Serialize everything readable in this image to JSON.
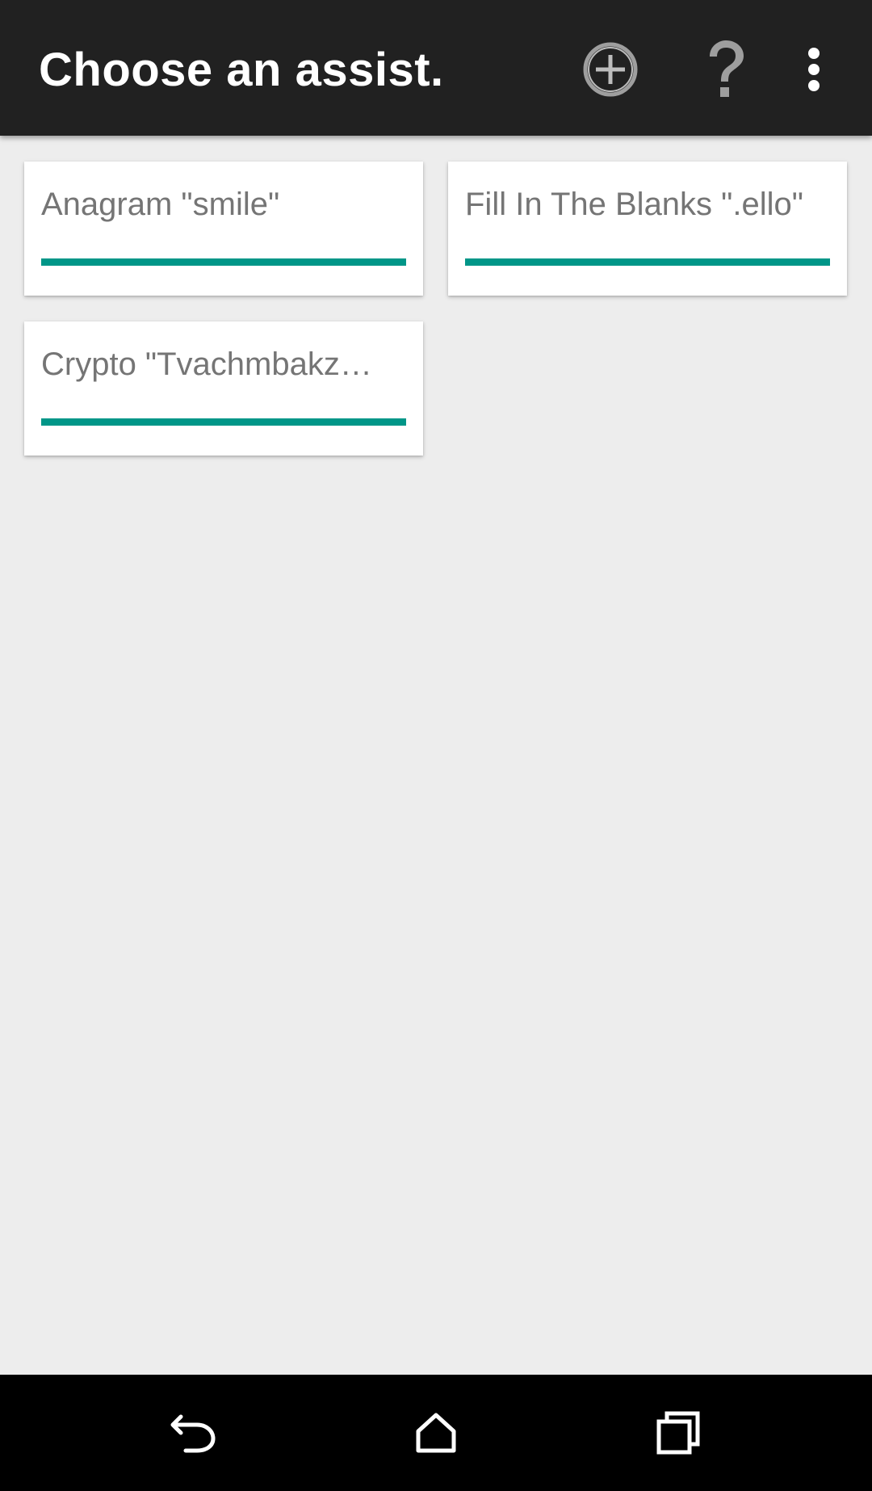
{
  "app_bar": {
    "title": "Choose an assist.",
    "background": "#212121",
    "actions": [
      {
        "icon": "add-circle-icon"
      },
      {
        "icon": "help-icon"
      },
      {
        "icon": "more-vert-icon"
      }
    ]
  },
  "cards": [
    {
      "label": "Anagram \"smile\"",
      "progress": 1.0
    },
    {
      "label": "Fill In The Blanks \".ello\"",
      "progress": 1.0
    },
    {
      "label": "Crypto \"Tvachmbakz…",
      "progress": 1.0
    }
  ],
  "colors": {
    "accent": "#009688",
    "card_text": "#757575",
    "background": "#ededed"
  },
  "nav_bar": {
    "buttons": [
      {
        "icon": "back-icon"
      },
      {
        "icon": "home-icon"
      },
      {
        "icon": "recent-apps-icon"
      }
    ]
  }
}
